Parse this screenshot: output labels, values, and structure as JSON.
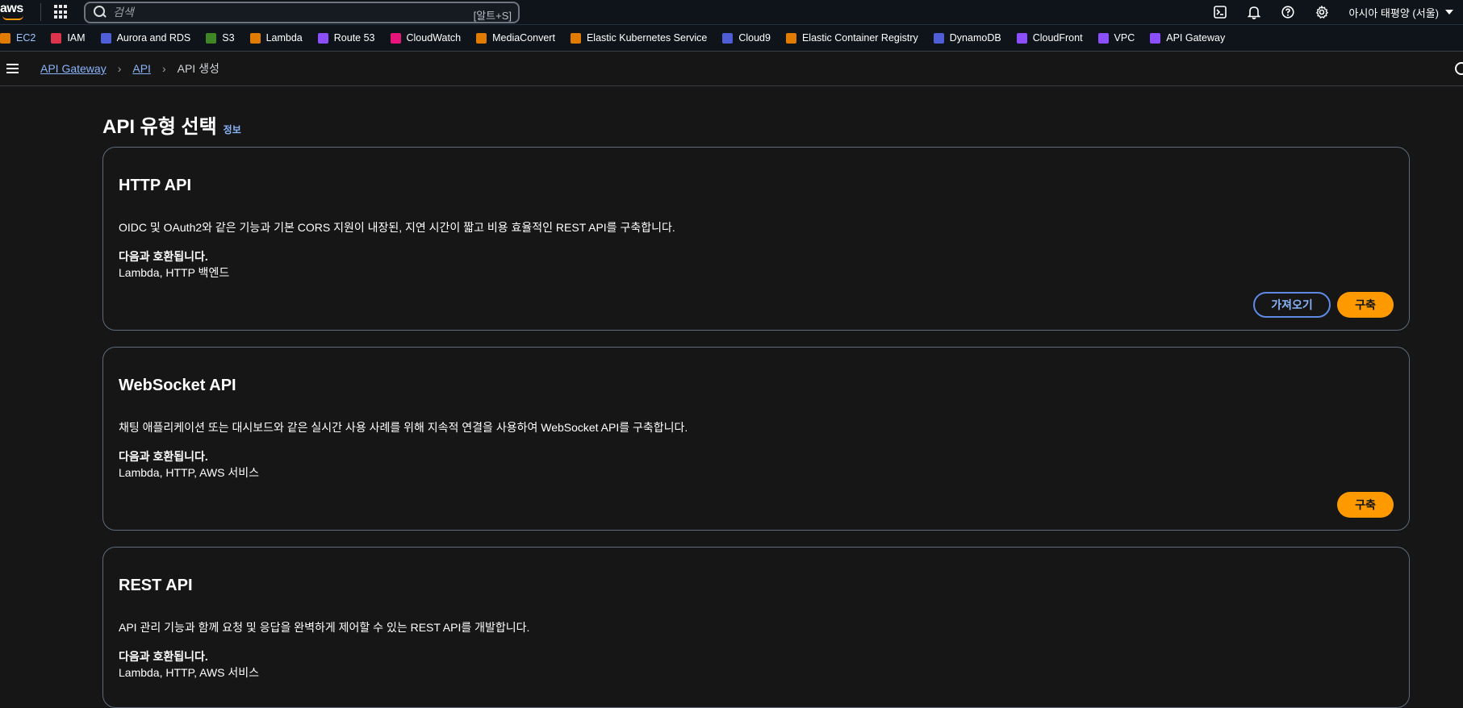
{
  "topbar": {
    "logo_text": "aws",
    "search_placeholder": "검색",
    "search_shortcut": "[알트+S]",
    "region_label": "아시아 태평양 (서울)",
    "icons": [
      "cloudshell-icon",
      "bell-icon",
      "help-icon",
      "settings-icon"
    ]
  },
  "favorites": [
    {
      "label": "EC2",
      "color": "#e07b00"
    },
    {
      "label": "IAM",
      "color": "#dd344c"
    },
    {
      "label": "Aurora and RDS",
      "color": "#4f5dd6"
    },
    {
      "label": "S3",
      "color": "#3f8624"
    },
    {
      "label": "Lambda",
      "color": "#e07b00"
    },
    {
      "label": "Route 53",
      "color": "#8c4fff"
    },
    {
      "label": "CloudWatch",
      "color": "#e7157b"
    },
    {
      "label": "MediaConvert",
      "color": "#e07b00"
    },
    {
      "label": "Elastic Kubernetes Service",
      "color": "#e07b00"
    },
    {
      "label": "Cloud9",
      "color": "#4f5dd6"
    },
    {
      "label": "Elastic Container Registry",
      "color": "#e07b00"
    },
    {
      "label": "DynamoDB",
      "color": "#4f5dd6"
    },
    {
      "label": "CloudFront",
      "color": "#8c4fff"
    },
    {
      "label": "VPC",
      "color": "#8c4fff"
    },
    {
      "label": "API Gateway",
      "color": "#8c4fff"
    }
  ],
  "breadcrumb": {
    "items": [
      "API Gateway",
      "API"
    ],
    "current": "API 생성"
  },
  "page": {
    "title": "API 유형 선택",
    "info_link": "정보"
  },
  "cards": [
    {
      "title": "HTTP API",
      "description": "OIDC 및 OAuth2와 같은 기능과 기본 CORS 지원이 내장된, 지연 시간이 짧고 비용 효율적인 REST API를 구축합니다.",
      "compat_label": "다음과 호환됩니다.",
      "compat_value": "Lambda, HTTP 백엔드",
      "secondary_button": "가져오기",
      "primary_button": "구축"
    },
    {
      "title": "WebSocket API",
      "description": "채팅 애플리케이션 또는 대시보드와 같은 실시간 사용 사례를 위해 지속적 연결을 사용하여 WebSocket API를 구축합니다.",
      "compat_label": "다음과 호환됩니다.",
      "compat_value": "Lambda, HTTP, AWS 서비스",
      "primary_button": "구축"
    },
    {
      "title": "REST API",
      "description": "API 관리 기능과 함께 요청 및 응답을 완벽하게 제어할 수 있는 REST API를 개발합니다.",
      "compat_label": "다음과 호환됩니다.",
      "compat_value": "Lambda, HTTP, AWS 서비스"
    }
  ],
  "colors": {
    "accent": "#ff9900",
    "link": "#89b4fa",
    "background": "#161616",
    "header": "#0f141a"
  }
}
